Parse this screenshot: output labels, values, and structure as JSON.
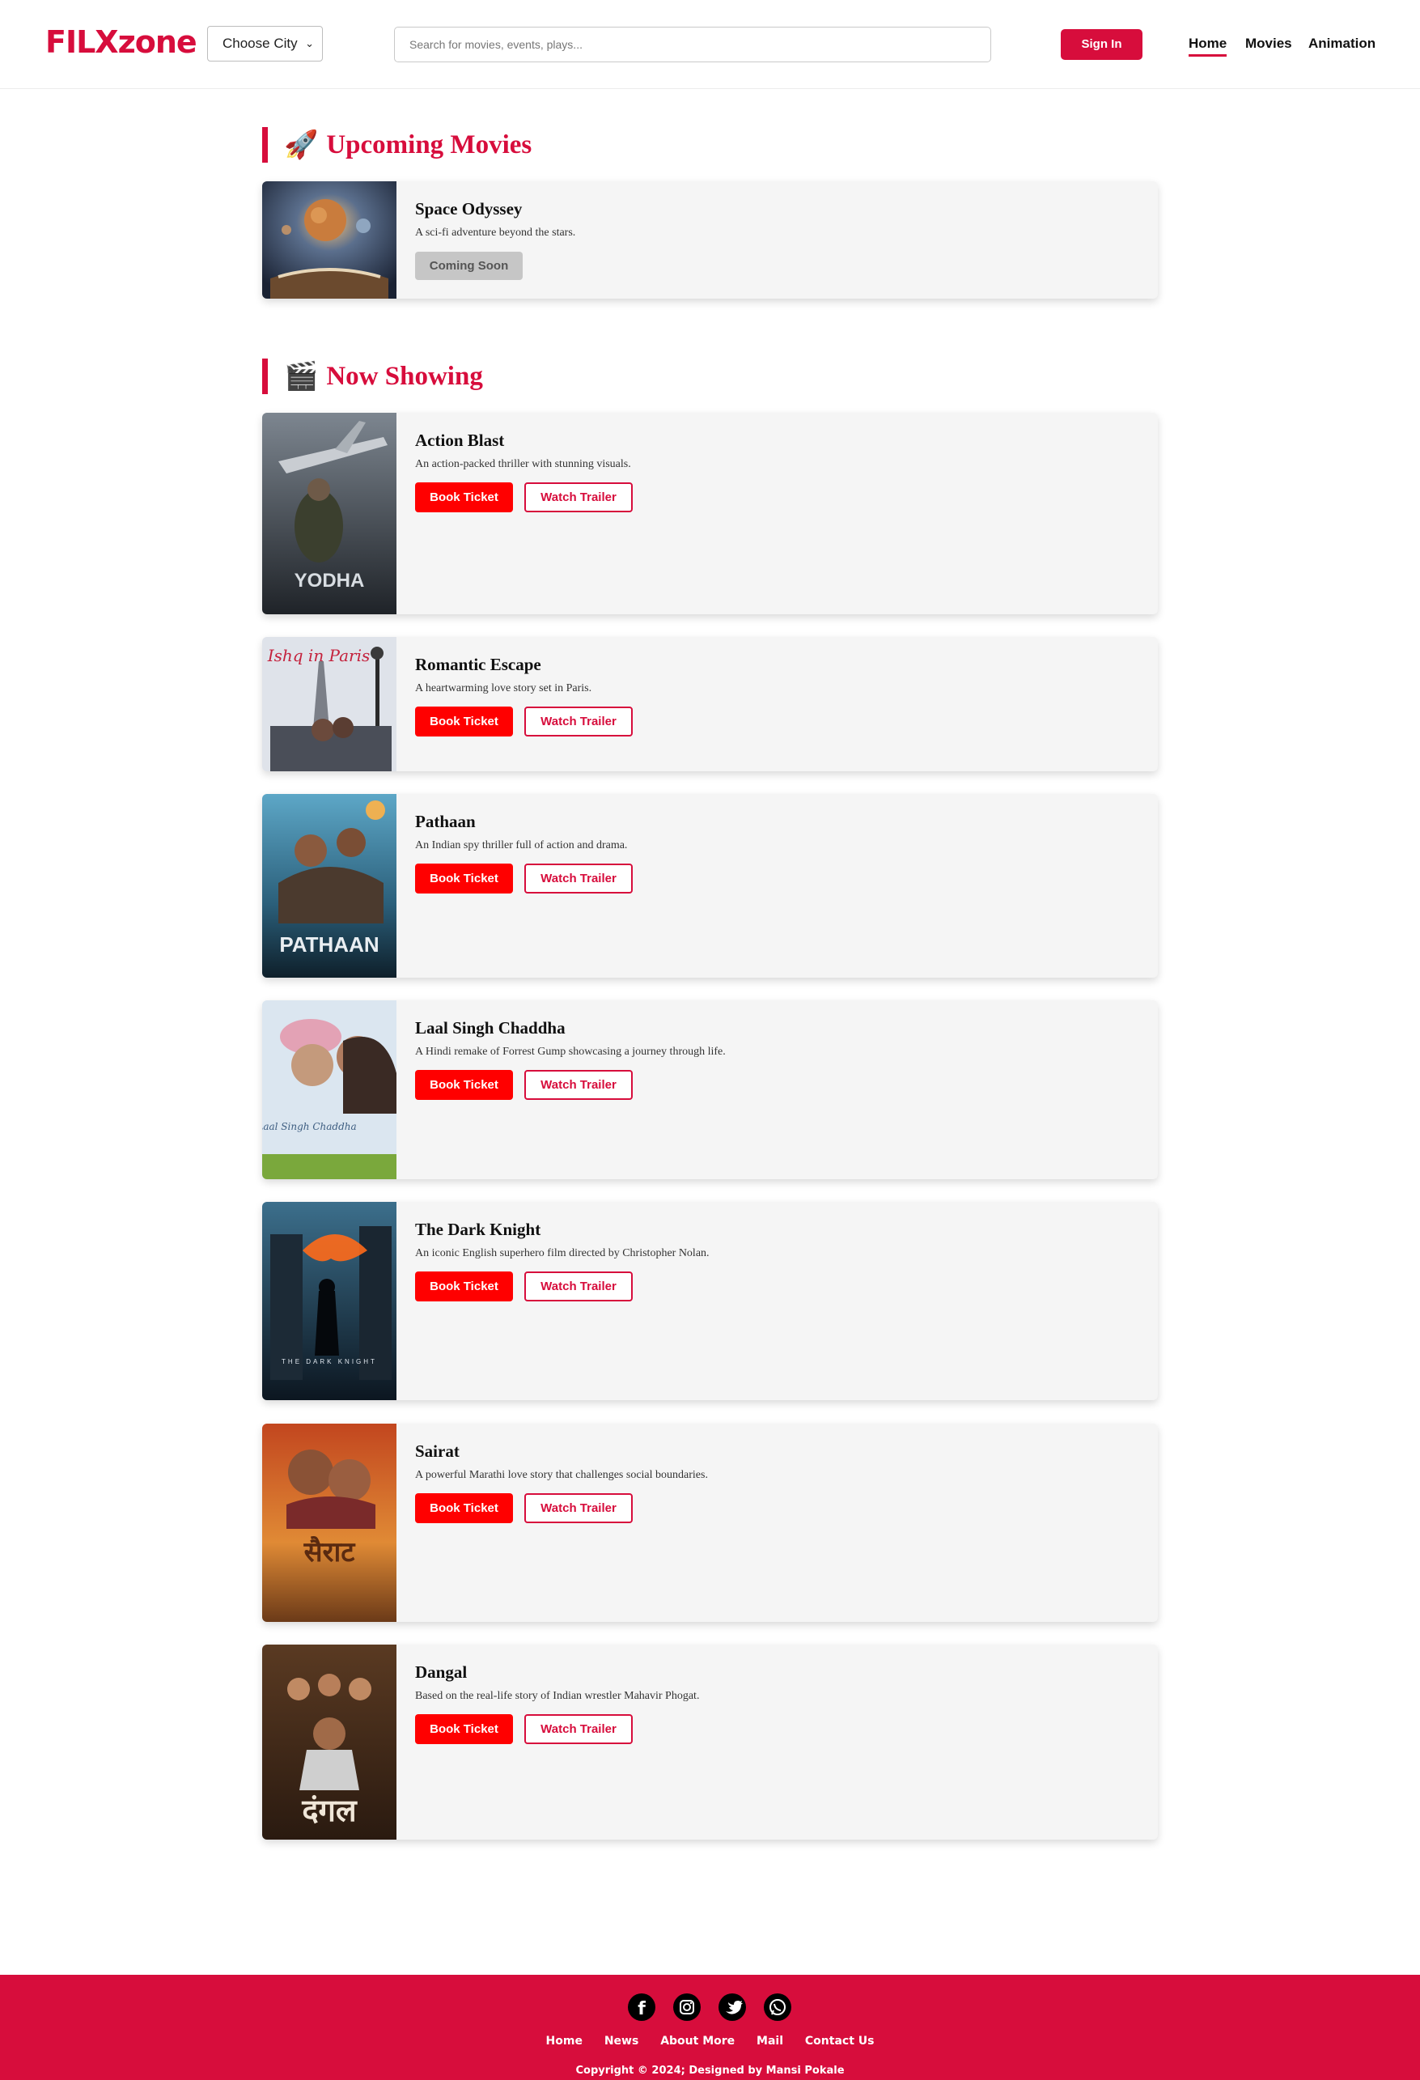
{
  "header": {
    "logo": "FILXzone",
    "city_select": "Choose City",
    "search_placeholder": "Search for movies, events, plays...",
    "sign_in": "Sign In",
    "nav": [
      "Home",
      "Movies",
      "Animation"
    ],
    "active_nav": "Home"
  },
  "upcoming": {
    "title": "Upcoming Movies",
    "icon": "rocket-icon",
    "movies": [
      {
        "title": "Space Odyssey",
        "description": "A sci-fi adventure beyond the stars.",
        "button": "Coming Soon"
      }
    ]
  },
  "now_showing": {
    "title": "Now Showing",
    "icon": "clapper-board-icon",
    "book_label": "Book Ticket",
    "trailer_label": "Watch Trailer",
    "movies": [
      {
        "title": "Action Blast",
        "description": "An action-packed thriller with stunning visuals.",
        "poster_text": "YODHA"
      },
      {
        "title": "Romantic Escape",
        "description": "A heartwarming love story set in Paris.",
        "poster_text": "Ishq in Paris"
      },
      {
        "title": "Pathaan",
        "description": "An Indian spy thriller full of action and drama.",
        "poster_text": "PATHAAN"
      },
      {
        "title": "Laal Singh Chaddha",
        "description": "A Hindi remake of Forrest Gump showcasing a journey through life.",
        "poster_text": "Laal Singh Chaddha"
      },
      {
        "title": "The Dark Knight",
        "description": "An iconic English superhero film directed by Christopher Nolan.",
        "poster_text": "THE DARK KNIGHT"
      },
      {
        "title": "Sairat",
        "description": "A powerful Marathi love story that challenges social boundaries.",
        "poster_text": "सैराट"
      },
      {
        "title": "Dangal",
        "description": "Based on the real-life story of Indian wrestler Mahavir Phogat.",
        "poster_text": "दंगल"
      }
    ]
  },
  "footer": {
    "social_icons": [
      "facebook-icon",
      "instagram-icon",
      "twitter-icon",
      "whatsapp-icon"
    ],
    "links": [
      "Home",
      "News",
      "About More",
      "Mail",
      "Contact Us"
    ],
    "copyright": "Copyright © 2024; Designed by",
    "designer": "Mansi Pokale"
  },
  "colors": {
    "brand": "#d70d3c",
    "book_button": "#ff0000",
    "footer_bg": "#d70d3c"
  }
}
